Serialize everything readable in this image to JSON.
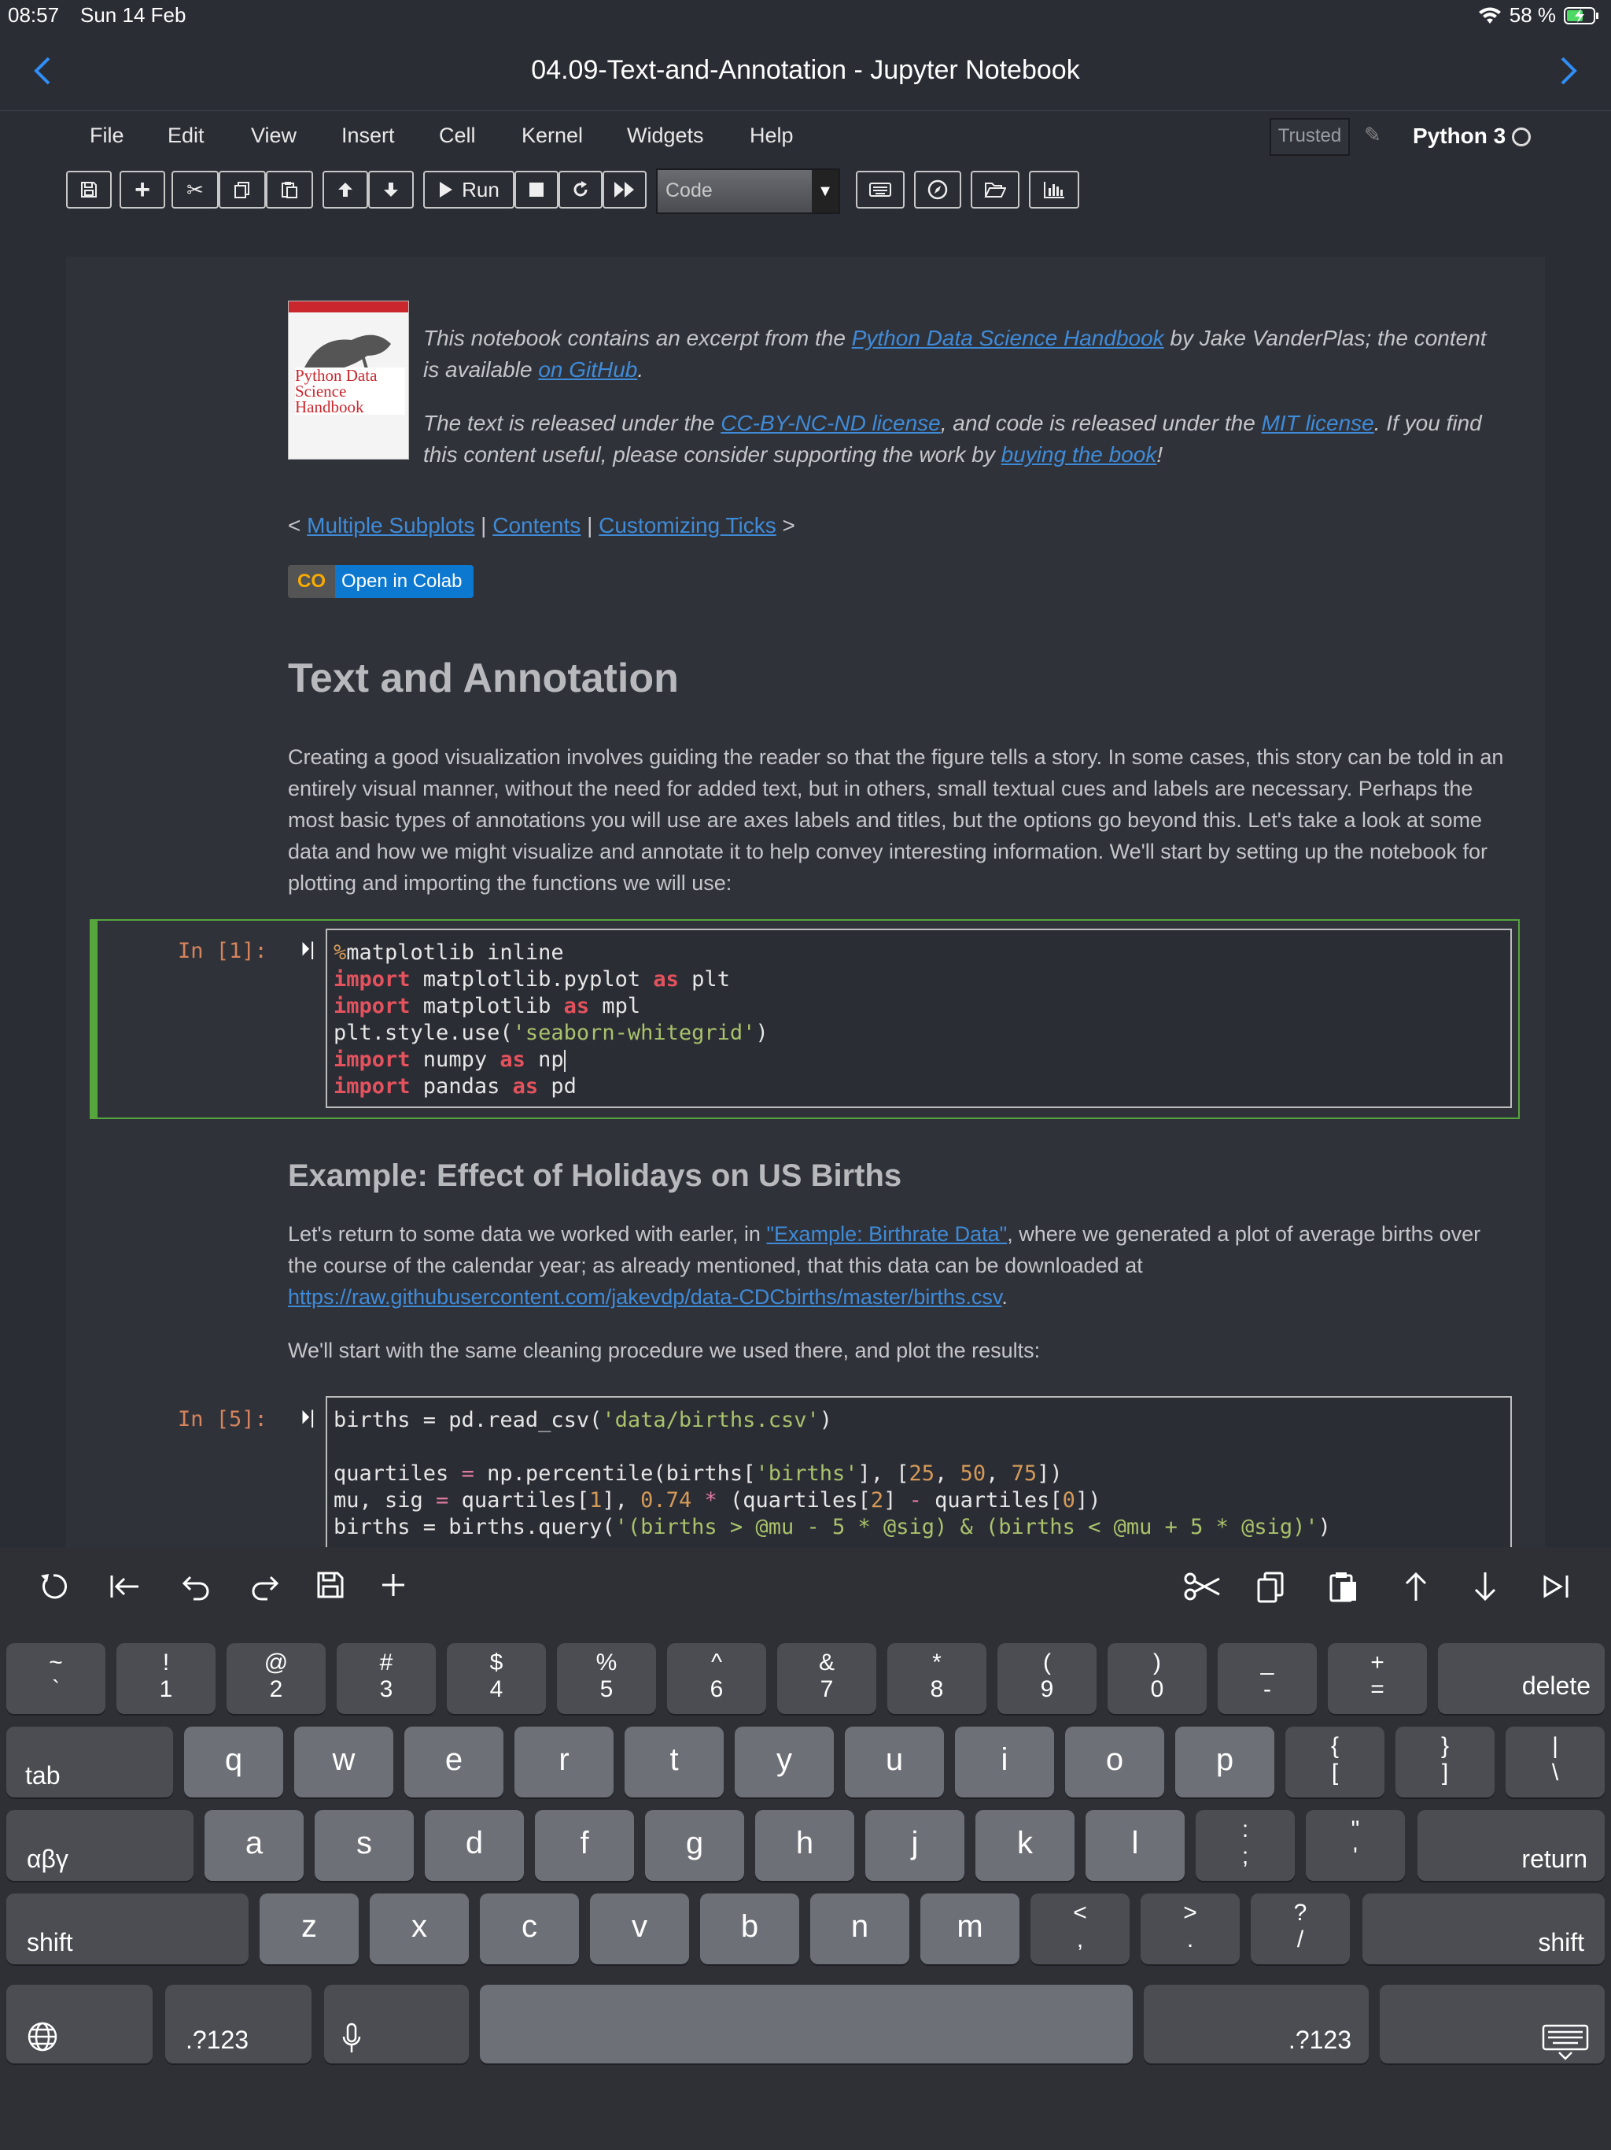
{
  "status": {
    "time": "08:57",
    "date": "Sun 14 Feb",
    "battery": "58 %"
  },
  "nav": {
    "title": "04.09-Text-and-Annotation - Jupyter Notebook"
  },
  "menu": {
    "items": [
      "File",
      "Edit",
      "View",
      "Insert",
      "Cell",
      "Kernel",
      "Widgets",
      "Help"
    ],
    "trusted": "Trusted",
    "kernel": "Python 3"
  },
  "toolbar": {
    "run_label": "Run",
    "cell_type": "Code"
  },
  "book": {
    "cover_title": "Python Data Science Handbook"
  },
  "intro": {
    "p1_a": "This notebook contains an excerpt from the ",
    "p1_link": "Python Data Science Handbook",
    "p1_b": " by Jake VanderPlas; the content is available ",
    "p1_link2": "on GitHub",
    "p1_c": ".",
    "p2_a": "The text is released under the ",
    "p2_link": "CC-BY-NC-ND license",
    "p2_b": ", and code is released under the ",
    "p2_link2": "MIT license",
    "p2_c": ". If you find this content useful, please consider supporting the work by ",
    "p2_link3": "buying the book",
    "p2_d": "!"
  },
  "navlinks": {
    "prev": "Multiple Subplots",
    "contents": "Contents",
    "next": "Customizing Ticks"
  },
  "colab": {
    "label": "Open in Colab"
  },
  "heading1": "Text and Annotation",
  "para1": "Creating a good visualization involves guiding the reader so that the figure tells a story. In some cases, this story can be told in an entirely visual manner, without the need for added text, but in others, small textual cues and labels are necessary. Perhaps the most basic types of annotations you will use are axes labels and titles, but the options go beyond this. Let's take a look at some data and how we might visualize and annotate it to help convey interesting information. We'll start by setting up the notebook for plotting and importing the functions we will use:",
  "cell1": {
    "prompt": "In [1]:"
  },
  "heading2": "Example: Effect of Holidays on US Births",
  "para2": {
    "a": "Let's return to some data we worked with earler, in ",
    "link": "\"Example: Birthrate Data\"",
    "b": ", where we generated a plot of average births over the course of the calendar year; as already mentioned, that this data can be downloaded at ",
    "url": "https://raw.githubusercontent.com/jakevdp/data-CDCbirths/master/births.csv",
    "c": "."
  },
  "para3": "We'll start with the same cleaning procedure we used there, and plot the results:",
  "cell2": {
    "prompt": "In [5]:"
  },
  "keyboard": {
    "row1": [
      [
        "~",
        "`"
      ],
      [
        "!",
        "1"
      ],
      [
        "@",
        "2"
      ],
      [
        "#",
        "3"
      ],
      [
        "$",
        "4"
      ],
      [
        "%",
        "5"
      ],
      [
        "^",
        "6"
      ],
      [
        "&",
        "7"
      ],
      [
        "*",
        "8"
      ],
      [
        "(",
        "9"
      ],
      [
        ")",
        "0"
      ],
      [
        "_",
        "-"
      ],
      [
        "+",
        "="
      ]
    ],
    "delete": "delete",
    "tab": "tab",
    "row2": [
      "q",
      "w",
      "e",
      "r",
      "t",
      "y",
      "u",
      "i",
      "o",
      "p"
    ],
    "row2_sym": [
      [
        "{",
        "["
      ],
      [
        "}",
        "]"
      ],
      [
        "|",
        "\\"
      ]
    ],
    "alt": "αβγ",
    "row3": [
      "a",
      "s",
      "d",
      "f",
      "g",
      "h",
      "j",
      "k",
      "l"
    ],
    "row3_sym": [
      [
        ":",
        ";"
      ],
      [
        "\"",
        "'"
      ]
    ],
    "return": "return",
    "shift": "shift",
    "row4": [
      "z",
      "x",
      "c",
      "v",
      "b",
      "n",
      "m"
    ],
    "row4_sym": [
      [
        "<",
        ","
      ],
      [
        ">",
        "."
      ],
      [
        "?",
        "/"
      ]
    ],
    "num": ".?123"
  }
}
